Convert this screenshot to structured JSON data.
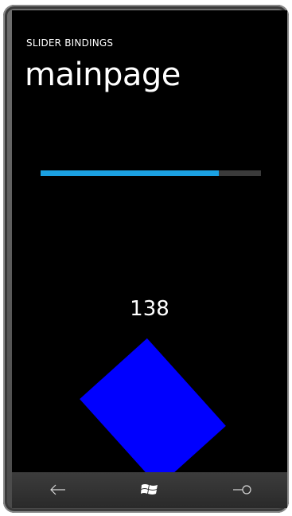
{
  "app": {
    "title": "SLIDER BINDINGS",
    "page_title": "mainpage"
  },
  "slider": {
    "value": 138,
    "max": 171,
    "accent_color": "#1ba1e2",
    "track_color": "#3a3a3a"
  },
  "display": {
    "value_text": "138"
  },
  "shape": {
    "color": "#0000ff",
    "rotation_degrees": 138
  },
  "navbar": {
    "back_icon": "back-arrow-icon",
    "start_icon": "windows-logo-icon",
    "search_icon": "search-icon"
  }
}
